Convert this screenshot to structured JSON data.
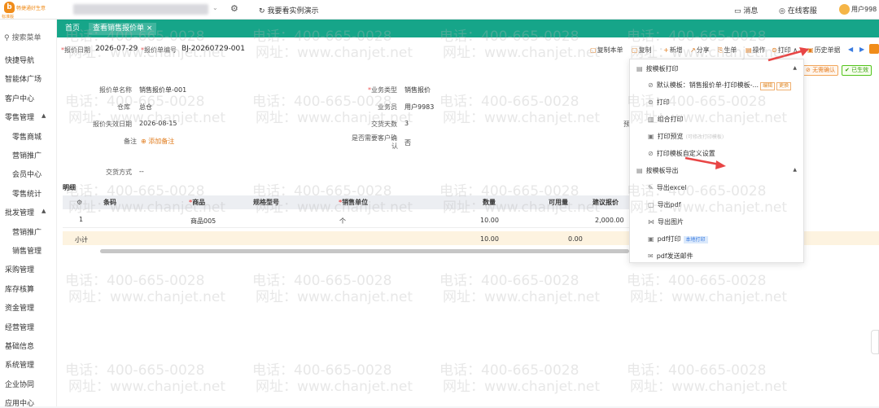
{
  "topbar": {
    "logo_mark": "b",
    "logo_name": "畅捷通好生意",
    "logo_edition": "标准版",
    "account_chevron": "⌄",
    "gear_icon": "gear-icon",
    "demo_icon": "↻",
    "demo_text": "我要看实例演示",
    "messages": "消息",
    "messages_icon": "▭",
    "service": "在线客服",
    "service_icon": "◎",
    "user": "用户998"
  },
  "sidebar": {
    "search": "搜索菜单",
    "search_icon": "⚲",
    "items": [
      {
        "label": "快捷导航"
      },
      {
        "label": "智能体广场"
      },
      {
        "label": "客户中心"
      },
      {
        "label": "零售管理",
        "caret": "▲"
      },
      {
        "label": "零售商城"
      },
      {
        "label": "营销推广"
      },
      {
        "label": "会员中心"
      },
      {
        "label": "零售统计"
      },
      {
        "label": "批发管理",
        "caret": "▲"
      },
      {
        "label": "营销推广"
      },
      {
        "label": "销售管理"
      },
      {
        "label": "采购管理"
      },
      {
        "label": "库存核算"
      },
      {
        "label": "资金管理"
      },
      {
        "label": "经营管理"
      },
      {
        "label": "基础信息"
      },
      {
        "label": "系统管理"
      },
      {
        "label": "企业协同"
      },
      {
        "label": "应用中心"
      }
    ]
  },
  "tabs": {
    "home": "首页",
    "active": "查看销售报价单",
    "close": "×"
  },
  "header": {
    "date_label": "报价日期",
    "date_value": "2026-07-29",
    "number_label": "报价单编号",
    "number_value": "BJ-20260729-001"
  },
  "toolbar": {
    "copy_doc": "复制本单",
    "copy": "复制",
    "new": "新增",
    "share": "分享",
    "generate": "生单",
    "operate": "操作",
    "print": "打印",
    "history": "历史单据",
    "caret_up": "∧",
    "nav_prev": "◀",
    "nav_next": "▶"
  },
  "form": {
    "name_label": "报价单名称",
    "name_value": "销售报价单-001",
    "warehouse_label": "仓库",
    "warehouse_value": "总仓",
    "expire_label": "报价失效日期",
    "expire_value": "2026-08-15",
    "note_label": "备注",
    "note_add": "添加备注",
    "note_icon": "⊕",
    "delivery_label": "交货方式",
    "delivery_value": "--",
    "biz_type_label": "业务类型",
    "biz_type_value": "销售报价",
    "salesman_label": "业务员",
    "salesman_value": "用户9983",
    "days_label": "交货天数",
    "days_value": "3",
    "confirm_label_1": "是否需要客户确",
    "confirm_label_2": "认",
    "confirm_value": "否",
    "trunc_label": "预"
  },
  "status": {
    "pending": "无需确认",
    "effective": "已生效"
  },
  "detail": {
    "title": "明细",
    "columns": [
      "条码",
      "商品",
      "规格型号",
      "销售单位",
      "数量",
      "可用量",
      "建议报价"
    ],
    "row": {
      "index": "1",
      "product": "商品005",
      "unit": "个",
      "qty": "10.00",
      "price": "2,000.00"
    },
    "subtotal": {
      "label": "小计",
      "qty": "10.00",
      "avail": "0.00"
    },
    "settings_icon": "⚙"
  },
  "dropdown": {
    "group_print": "按模板打印",
    "default_template": "默认模板：销售报价单-打印模板-...",
    "edit": "编辑",
    "switch": "更换",
    "print": "打印",
    "combo_print": "组合打印",
    "preview": "打印预览",
    "preview_hint": "(可修改打印模板)",
    "custom_settings": "打印模板自定义设置",
    "group_export": "按模板导出",
    "export_excel": "导出excel",
    "export_pdf": "导出pdf",
    "export_image": "导出图片",
    "pdf_print": "pdf打印",
    "local_print": "本地打印",
    "pdf_email": "pdf发送邮件",
    "collapse": "▲"
  },
  "watermark": {
    "phone": "电话：400-665-0028",
    "site": "网址：www.chanjet.net"
  },
  "colors": {
    "brand_teal": "#16a589",
    "accent_orange": "#e07b1c",
    "arrow_red": "#e84545"
  }
}
